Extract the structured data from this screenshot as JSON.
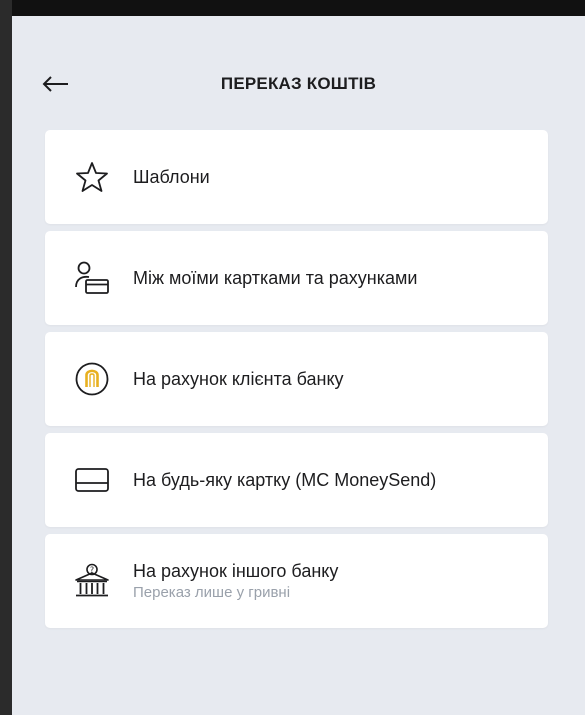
{
  "header": {
    "title": "ПЕРЕКАЗ КОШТІВ",
    "back_icon": "arrow-left-icon"
  },
  "menu": {
    "items": [
      {
        "label": "Шаблони",
        "icon": "star-icon"
      },
      {
        "label": "Між моїми картками та рахунками",
        "icon": "user-card-icon"
      },
      {
        "label": "На рахунок клієнта банку",
        "icon": "bank-client-icon"
      },
      {
        "label": "На будь-яку картку (MC MoneySend)",
        "icon": "card-icon"
      },
      {
        "label": "На рахунок іншого банку",
        "sublabel": "Переказ лише у гривні",
        "icon": "bank-building-icon"
      }
    ]
  },
  "colors": {
    "background": "#e7eaf0",
    "card": "#ffffff",
    "text": "#1d1d1f",
    "secondary_text": "#9aa1ab",
    "accent": "#e8b020"
  }
}
